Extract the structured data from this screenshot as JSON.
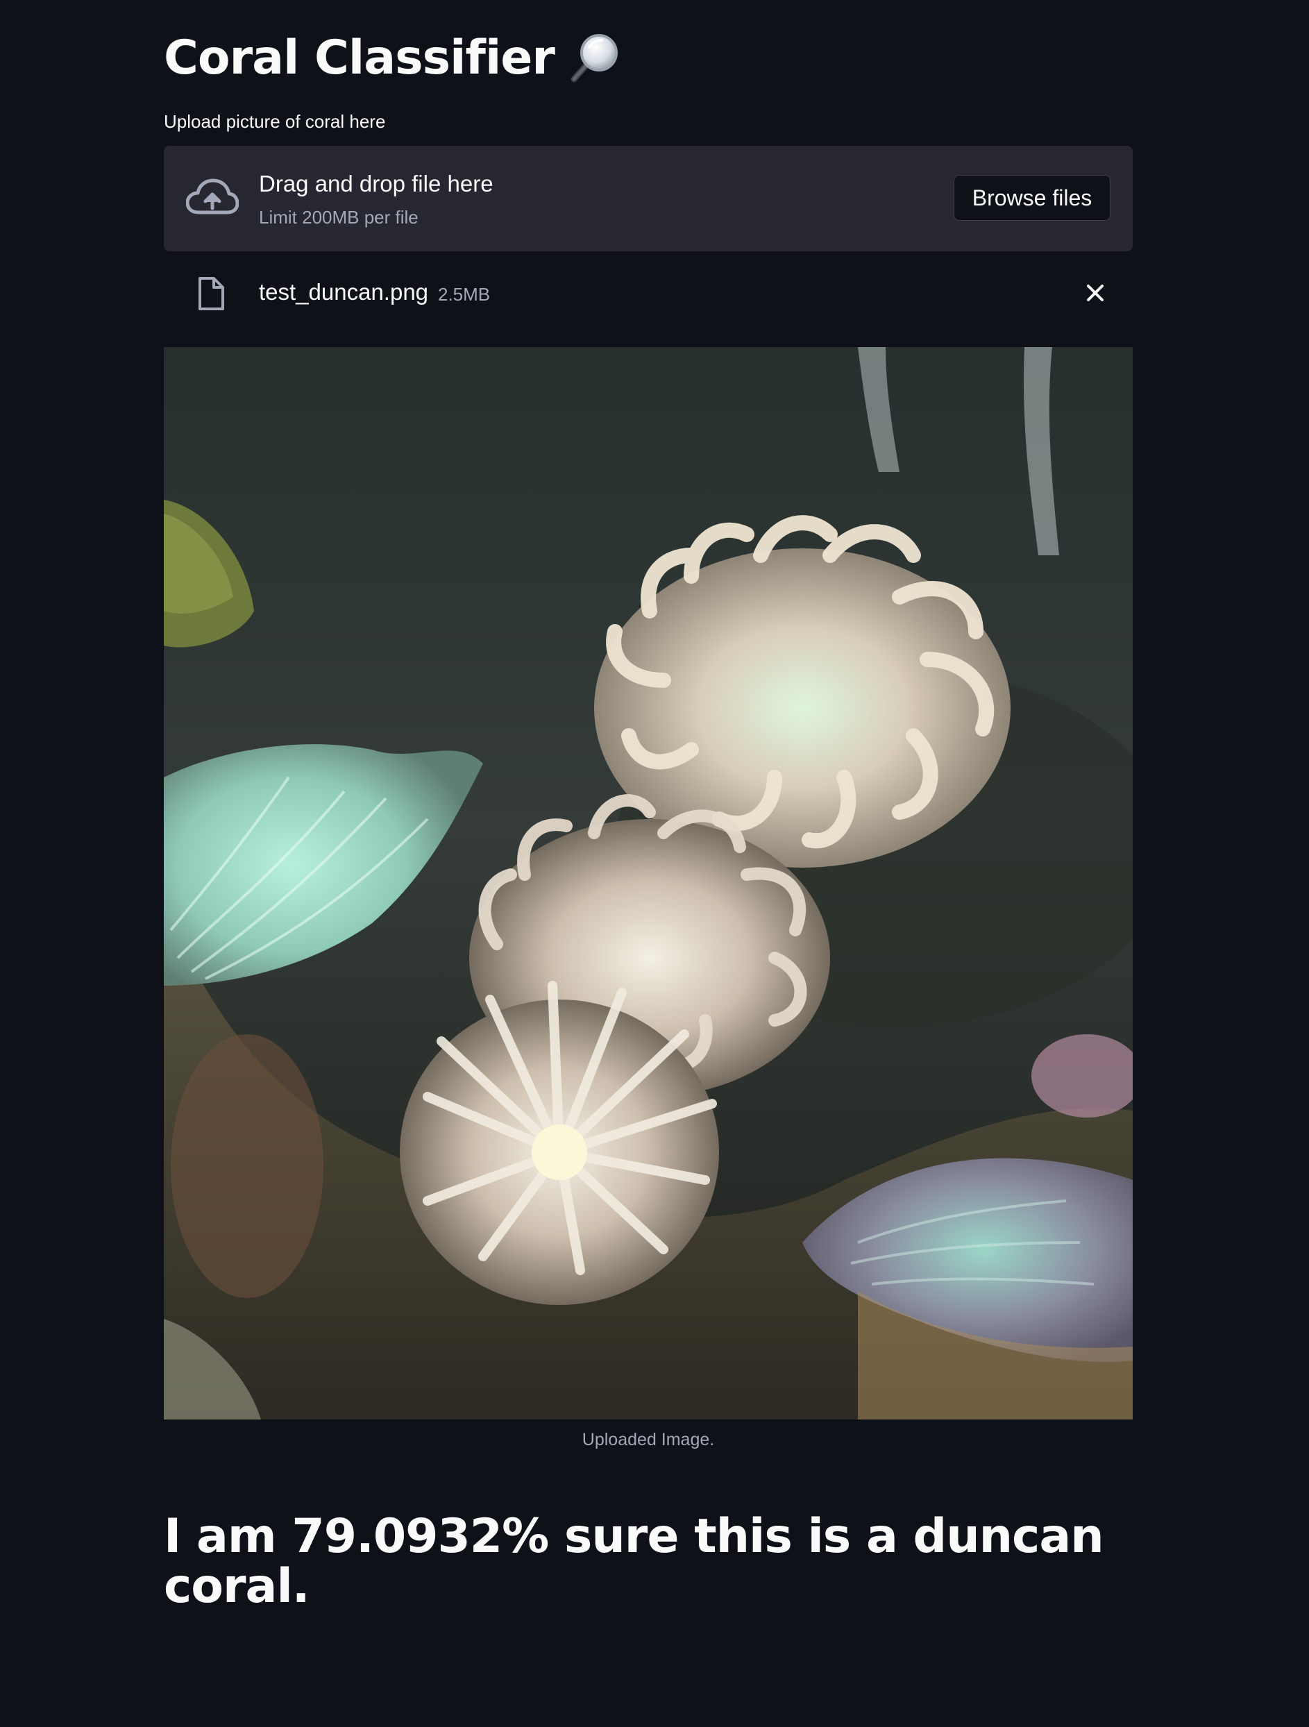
{
  "page": {
    "title": "Coral Classifier",
    "title_icon": "magnifier-icon"
  },
  "uploader": {
    "label": "Upload picture of coral here",
    "drop_title": "Drag and drop file here",
    "limit_text": "Limit 200MB per file",
    "browse_label": "Browse files",
    "cloud_icon": "cloud-upload-icon"
  },
  "uploaded_file": {
    "name": "test_duncan.png",
    "size": "2.5MB",
    "file_icon": "file-icon",
    "remove_icon": "close-icon"
  },
  "image": {
    "caption": "Uploaded Image."
  },
  "result": {
    "text": "I am 79.0932% sure this is a duncan coral."
  },
  "colors": {
    "background": "#0e1117",
    "panel": "#262730",
    "text": "#fafafa",
    "muted": "#a3a8b8"
  }
}
